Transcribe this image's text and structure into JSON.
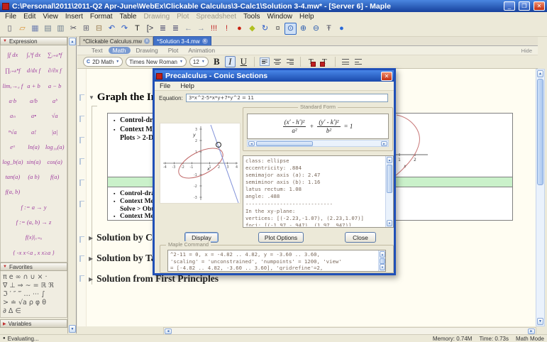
{
  "titlebar": {
    "title": "C:\\Personal\\2011\\2011-Q2 Apr-June\\WebEx\\Clickable Calculus\\3-Calc1\\Solution 3-4.mw* - [Server 6] - Maple"
  },
  "menubar": {
    "items": [
      {
        "label": "File"
      },
      {
        "label": "Edit"
      },
      {
        "label": "View"
      },
      {
        "label": "Insert"
      },
      {
        "label": "Format"
      },
      {
        "label": "Table"
      },
      {
        "label": "Drawing",
        "disabled": true
      },
      {
        "label": "Plot",
        "disabled": true
      },
      {
        "label": "Spreadsheet",
        "disabled": true
      },
      {
        "label": "Tools"
      },
      {
        "label": "Window"
      },
      {
        "label": "Help"
      }
    ]
  },
  "toolbar": {
    "icons": [
      {
        "name": "new-document-icon",
        "glyph": "▯",
        "color": "#556"
      },
      {
        "name": "open-folder-icon",
        "glyph": "▱",
        "color": "#d89030"
      },
      {
        "name": "save-icon",
        "glyph": "▦",
        "color": "#7080b0"
      },
      {
        "name": "print-icon",
        "glyph": "▤",
        "color": "#708090"
      },
      {
        "name": "print-preview-icon",
        "glyph": "▥",
        "color": "#708090"
      },
      {
        "name": "cut-icon",
        "glyph": "✂",
        "color": "#445"
      },
      {
        "name": "copy-icon",
        "glyph": "⊞",
        "color": "#667"
      },
      {
        "name": "paste-icon",
        "glyph": "⊟",
        "color": "#997c50"
      },
      {
        "name": "undo-icon",
        "glyph": "↶",
        "color": "#2858c8"
      },
      {
        "name": "redo-icon",
        "glyph": "↷",
        "color": "#2858c8"
      },
      {
        "name": "text-mode-icon",
        "glyph": "T",
        "color": "#222"
      },
      {
        "name": "math-mode-icon",
        "glyph": "[>",
        "color": "#334"
      },
      {
        "name": "indent-icon",
        "glyph": "≣",
        "color": "#557"
      },
      {
        "name": "outdent-icon",
        "glyph": "≣",
        "color": "#557"
      },
      {
        "name": "back-icon",
        "glyph": "←",
        "color": "#8a94a4"
      },
      {
        "name": "forward-icon",
        "glyph": "→",
        "color": "#8a94a4"
      },
      {
        "name": "execute-all-icon",
        "glyph": "!!!",
        "color": "#c02020"
      },
      {
        "name": "execute-icon",
        "glyph": "!",
        "color": "#c02020"
      },
      {
        "name": "interrupt-icon",
        "glyph": "●",
        "color": "#c82010"
      },
      {
        "name": "debug-icon",
        "glyph": "◆",
        "color": "#b0c020"
      },
      {
        "name": "restart-icon",
        "glyph": "↻",
        "color": "#2858c8"
      },
      {
        "name": "options-icon",
        "glyph": "¤",
        "color": "#555"
      },
      {
        "name": "zoom-default-icon",
        "glyph": "⊙",
        "color": "#3060b0",
        "active": true
      },
      {
        "name": "zoom-in-icon",
        "glyph": "⊕",
        "color": "#3060b0"
      },
      {
        "name": "zoom-out-icon",
        "glyph": "⊖",
        "color": "#3060b0"
      },
      {
        "name": "tab-marks-icon",
        "glyph": "Ŧ",
        "color": "#556"
      },
      {
        "name": "help-icon",
        "glyph": "●",
        "color": "#2868d8"
      }
    ]
  },
  "tabs": [
    {
      "label": "*Clickable Calculus.mw",
      "close": "x"
    },
    {
      "label": "*Solution 3-4.mw",
      "close": "x",
      "active": true
    }
  ],
  "context_bar": {
    "modes": [
      {
        "label": "Text"
      },
      {
        "label": "Math",
        "active": true
      },
      {
        "label": "Drawing"
      },
      {
        "label": "Plot"
      },
      {
        "label": "Animation"
      }
    ],
    "hide": "Hide"
  },
  "format_bar": {
    "style_icon": "C",
    "style": "2D Math",
    "font": "Times New Roman",
    "size": "12",
    "bold": "B",
    "italic": "I",
    "underline": "U",
    "dropdown_arrow": "▼"
  },
  "palettes": {
    "expression": {
      "marker": "▼",
      "title": "Expression",
      "items": [
        {
          "t": "∫f dx"
        },
        {
          "t": "∫ₐᵇf dx"
        },
        {
          "t": "∑ᵢ₌ₖⁿf"
        },
        {
          "t": "∏ᵢ₌ₖⁿf"
        },
        {
          "t": "d/dx f"
        },
        {
          "t": "∂/∂x f"
        },
        {
          "t": "limₓ→ₐ f"
        },
        {
          "t": "a + b"
        },
        {
          "t": "a − b"
        },
        {
          "t": "a·b"
        },
        {
          "t": "a/b"
        },
        {
          "t": "aᵇ"
        },
        {
          "t": "aₙ"
        },
        {
          "t": "a•"
        },
        {
          "t": "√a"
        },
        {
          "t": "ⁿ√a"
        },
        {
          "t": "a!"
        },
        {
          "t": "|a|"
        },
        {
          "t": "eᵃ"
        },
        {
          "t": "ln(a)"
        },
        {
          "t": "log₁₀(a)"
        },
        {
          "t": "log_b(a)"
        },
        {
          "t": "sin(a)"
        },
        {
          "t": "cos(a)"
        },
        {
          "t": "tan(a)"
        },
        {
          "t": "(a b)"
        },
        {
          "t": "f(a)"
        },
        {
          "t": "f(a, b)"
        },
        {
          "t": "f := a → y",
          "wide": true
        },
        {
          "t": "f := (a, b) → z",
          "wide": true
        },
        {
          "t": "f(x)|ₓ₌ₐ",
          "wide": true
        },
        {
          "t": "{ -x  x<a ,  x  x≥a }",
          "wide": true
        }
      ]
    },
    "favorites": {
      "marker": "▼",
      "title": "Favorites",
      "rows": [
        "π  e  ∞  ∩  ∪  ×  ·",
        "∇  ⊥  ⇒  ∼  =  ℝ  ℜ",
        "ℑ  ′  ″  ‴  …  ⋯  ∫",
        ">  ≐  √a  ρ  φ  θ",
        "∂  Δ  ∈"
      ]
    },
    "variables": {
      "marker": "▶",
      "title": "Variables"
    }
  },
  "document": {
    "section1": {
      "marker": "▼",
      "title": "Graph the Im"
    },
    "table1_bullets": [
      {
        "b": "▪",
        "text": "Control-dra"
      },
      {
        "b": "▪",
        "text": "Context Me"
      },
      {
        "b": "",
        "text": "Plots > 2-D"
      }
    ],
    "table2_bullets": [
      {
        "b": "▪",
        "text": "Control-dra"
      },
      {
        "b": "▪",
        "text": "Context Me"
      },
      {
        "b": "",
        "text": "Solve > Obt"
      },
      {
        "b": "▪",
        "text": "Context Me"
      }
    ],
    "collapsed_sections": [
      {
        "marker": "▶",
        "title": "Solution by C"
      },
      {
        "marker": "▶",
        "title": "Solution by Ta"
      },
      {
        "marker": "▶",
        "title": "Solution from First Principles"
      }
    ],
    "fragment_plot": {
      "tick1": "1",
      "tick2": "2",
      "xlabel": "x",
      "curve_color": "#c87878"
    }
  },
  "dialog": {
    "title": "Precalculus - Conic Sections",
    "close": "✕",
    "menus": [
      "File",
      "Help"
    ],
    "equation": {
      "label": "Equation:",
      "value": "3*x^2-5*x*y+7*y^2 = 11"
    },
    "standard_form": {
      "label": "Standard Form",
      "num1": "(x′ - h′)²",
      "den1": "a²",
      "op": "+",
      "num2": "(y′ - k′)²",
      "den2": "b²",
      "rhs": "= 1"
    },
    "info_text": "class: ellipse\neccentricity: .884\nsemimajor axis (a): 2.47\nsemiminor axis (b): 1.16\nlatus rectum: 1.08\nangle: .488\n----------------------------\nIn the xy-plane:\nvertices: [(-2.23,-1.07), (2.23,1.07)]\nfoci: [(-1.97,-.947), (1.97,.947)]",
    "buttons": {
      "display": "Display",
      "plot_options": "Plot Options",
      "close": "Close"
    },
    "maple_command": {
      "label": "Maple Command",
      "text": "^2-11 = 0, x = -4.82 .. 4.82, y = -3.60 .. 3.60,\n'scaling' = 'unconstrained', 'numpoints' = 1200, 'view'\n= [-4.82 .. 4.82, -3.60 .. 3.60], 'gridrefine'=2,"
    },
    "plot": {
      "xlabel": "x",
      "ylabel": "y",
      "x_ticks": [
        "-4",
        "-3",
        "-2",
        "-1",
        "1",
        "2",
        "3",
        "4"
      ],
      "y_ticks": [
        "3",
        "2",
        "1",
        "-1",
        "-2",
        "-3"
      ],
      "ellipse_color": "#c06868",
      "line_color": "#8090d8"
    }
  },
  "status_bar": {
    "evaluating": "Evaluating...",
    "memory": "Memory: 0.74M",
    "time": "Time: 0.73s",
    "mode": "Math Mode"
  }
}
